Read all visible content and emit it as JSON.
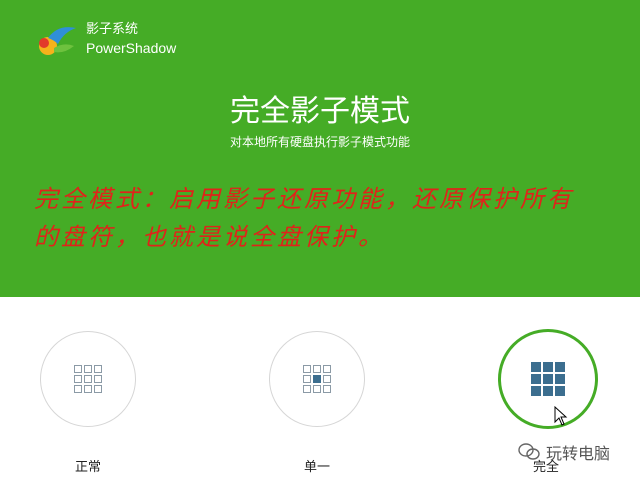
{
  "header": {
    "app_name": "影子系统",
    "app_subtitle": "PowerShadow",
    "mode_title": "完全影子模式",
    "mode_subtitle": "对本地所有硬盘执行影子模式功能",
    "background_color": "#45ac26"
  },
  "annotation": {
    "line1": "完全模式：启用影子还原功能，还原保护所有",
    "line2": "的盘符，也就是说全盘保护。",
    "color": "#e0231a"
  },
  "modes": [
    {
      "label": "正常",
      "icon": "grid-empty-icon",
      "selected": false
    },
    {
      "label": "单一",
      "icon": "grid-center-icon",
      "selected": false
    },
    {
      "label": "完全",
      "icon": "grid-full-icon",
      "selected": true
    }
  ],
  "watermark": {
    "text": "玩转电脑",
    "icon": "wechat-icon"
  }
}
